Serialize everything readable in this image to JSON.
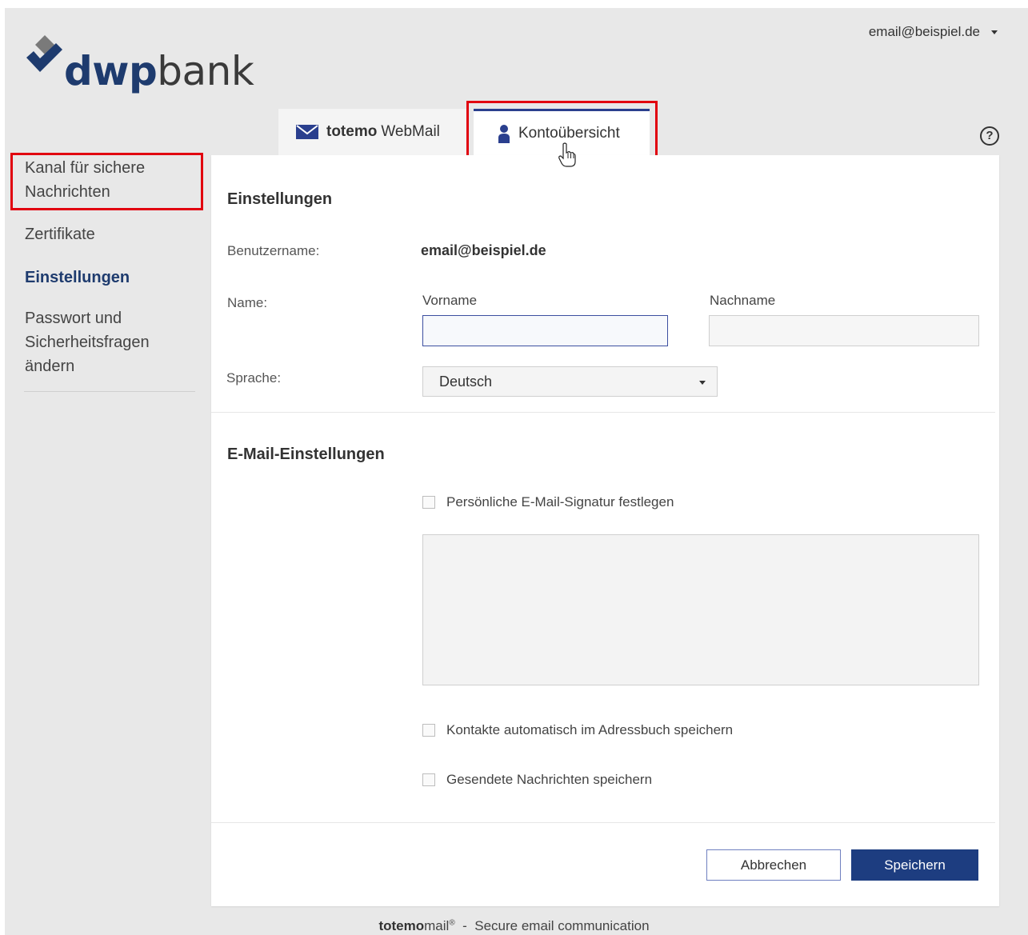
{
  "header": {
    "logo_bold": "dwp",
    "logo_light": "bank",
    "user_email": "email@beispiel.de"
  },
  "tabs": [
    {
      "label_bold": "totemo",
      "label": "WebMail",
      "icon": "envelope-icon"
    },
    {
      "label": "Kontoübersicht",
      "icon": "user-icon",
      "active": true
    }
  ],
  "help": {
    "label": "?"
  },
  "sidebar": {
    "items": [
      {
        "label": "Kanal für sichere Nachrichten"
      },
      {
        "label": "Zertifikate"
      },
      {
        "label": "Einstellungen",
        "active": true
      },
      {
        "label": "Passwort und Sicherheitsfragen ändern"
      }
    ]
  },
  "settings": {
    "title": "Einstellungen",
    "username_label": "Benutzername:",
    "username_value": "email@beispiel.de",
    "name_label": "Name:",
    "firstname_label": "Vorname",
    "firstname_value": "",
    "lastname_label": "Nachname",
    "lastname_value": "",
    "language_label": "Sprache:",
    "language_value": "Deutsch"
  },
  "email_settings": {
    "title": "E-Mail-Einstellungen",
    "signature_label": "Persönliche E-Mail-Signatur festlegen",
    "signature_value": "",
    "contacts_label": "Kontakte automatisch im Adressbuch speichern",
    "sent_label": "Gesendete Nachrichten speichern"
  },
  "buttons": {
    "cancel": "Abbrechen",
    "save": "Speichern"
  },
  "footer": {
    "brand_bold": "totemo",
    "brand_light": "mail",
    "registered": "®",
    "separator": "-",
    "tagline": "Secure email communication"
  },
  "colors": {
    "brand_blue": "#1e3b6e",
    "primary_button": "#1d3d80",
    "highlight_red": "#e1000f",
    "background": "#e8e8e8"
  }
}
